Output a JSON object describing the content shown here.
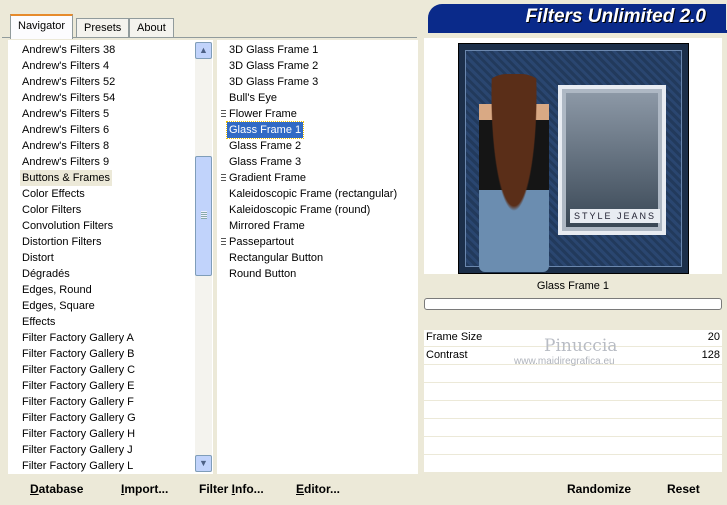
{
  "tabs": [
    {
      "label": "Navigator",
      "active": true
    },
    {
      "label": "Presets",
      "active": false
    },
    {
      "label": "About",
      "active": false
    }
  ],
  "app_title": "Filters Unlimited 2.0",
  "categories": [
    "Andrew's Filters 38",
    "Andrew's Filters 4",
    "Andrew's Filters 52",
    "Andrew's Filters 54",
    "Andrew's Filters 5",
    "Andrew's Filters 6",
    "Andrew's Filters 8",
    "Andrew's Filters 9",
    "Buttons & Frames",
    "Color Effects",
    "Color Filters",
    "Convolution Filters",
    "Distortion Filters",
    "Distort",
    "Dégradés",
    "Edges, Round",
    "Edges, Square",
    "Effects",
    "Filter Factory Gallery A",
    "Filter Factory Gallery B",
    "Filter Factory Gallery C",
    "Filter Factory Gallery E",
    "Filter Factory Gallery F",
    "Filter Factory Gallery G",
    "Filter Factory Gallery H",
    "Filter Factory Gallery J",
    "Filter Factory Gallery L"
  ],
  "selected_category": "Buttons & Frames",
  "filters": [
    {
      "label": "3D Glass Frame 1",
      "grip": false
    },
    {
      "label": "3D Glass Frame 2",
      "grip": false
    },
    {
      "label": "3D Glass Frame 3",
      "grip": false
    },
    {
      "label": "Bull's Eye",
      "grip": false
    },
    {
      "label": "Flower Frame",
      "grip": true
    },
    {
      "label": "Glass Frame 1",
      "grip": false
    },
    {
      "label": "Glass Frame 2",
      "grip": false
    },
    {
      "label": "Glass Frame 3",
      "grip": false
    },
    {
      "label": "Gradient Frame",
      "grip": true
    },
    {
      "label": "Kaleidoscopic Frame (rectangular)",
      "grip": false
    },
    {
      "label": "Kaleidoscopic Frame (round)",
      "grip": false
    },
    {
      "label": "Mirrored Frame",
      "grip": false
    },
    {
      "label": "Passepartout",
      "grip": true
    },
    {
      "label": "Rectangular Button",
      "grip": false
    },
    {
      "label": "Round Button",
      "grip": false
    }
  ],
  "selected_filter": "Glass Frame 1",
  "preview": {
    "selected_name": "Glass Frame 1",
    "frame_text": "STYLE JEANS"
  },
  "parameters": [
    {
      "name": "Frame Size",
      "value": "20"
    },
    {
      "name": "Contrast",
      "value": "128"
    }
  ],
  "watermark": {
    "name": "Pinuccia",
    "site": "www.maidiregrafica.eu"
  },
  "buttons": {
    "database": {
      "prefix": "D",
      "rest": "atabase"
    },
    "import": {
      "prefix": "I",
      "rest": "mport..."
    },
    "filter_info": {
      "prefix": "Filter ",
      "underline": "I",
      "rest": "nfo..."
    },
    "editor": {
      "prefix": "E",
      "rest": "ditor..."
    },
    "randomize": "Randomize",
    "reset": "Reset"
  },
  "colors": {
    "banner": "#0a2a8a",
    "selection": "#316ac5",
    "tab_accent": "#e68b2c"
  },
  "icons": {
    "scroll_up": "chevron-up-icon",
    "scroll_down": "chevron-down-icon"
  }
}
